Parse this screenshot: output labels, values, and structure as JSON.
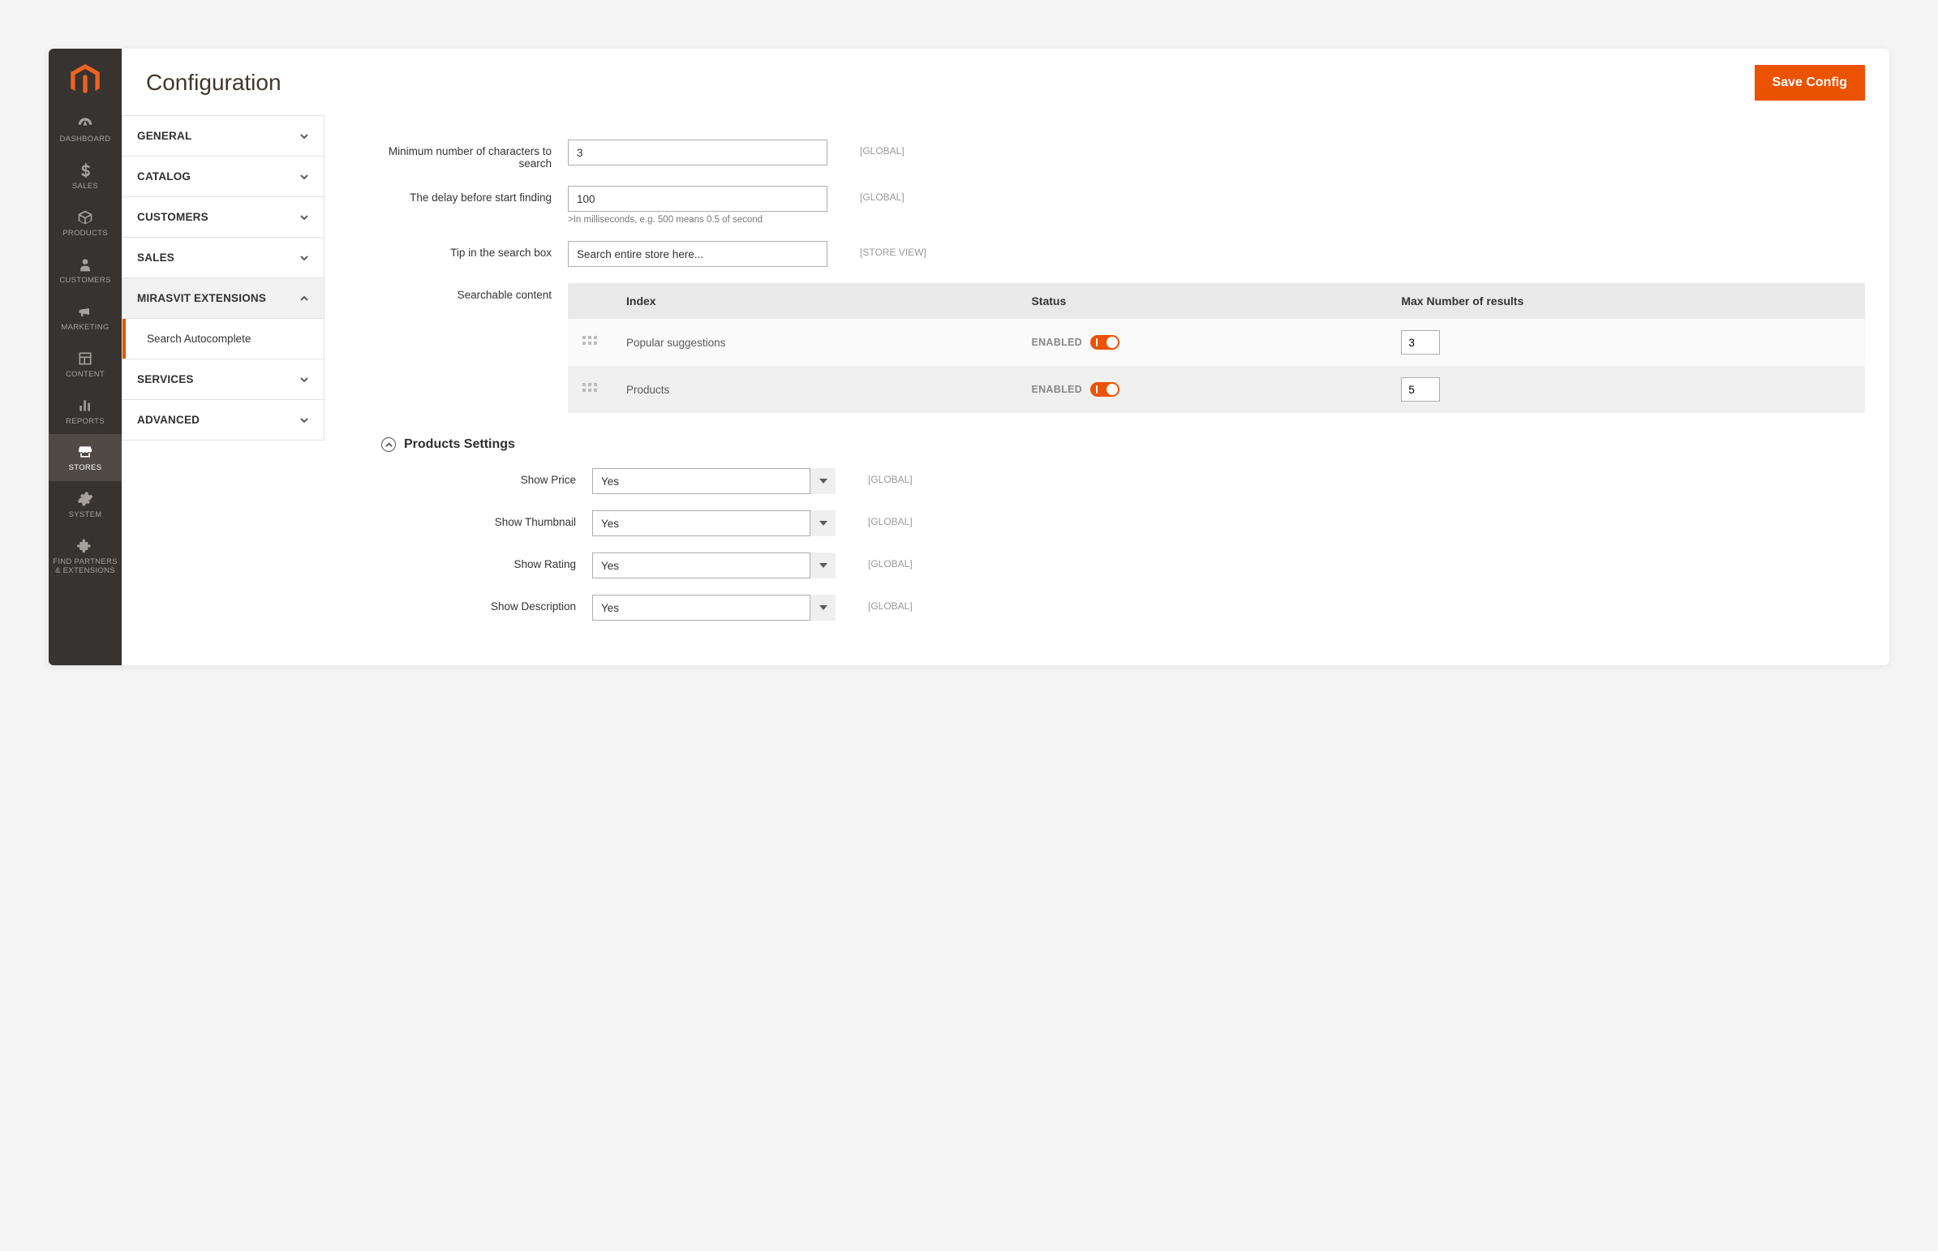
{
  "page": {
    "title": "Configuration",
    "save_button": "Save Config"
  },
  "sidebar": {
    "items": [
      {
        "id": "dashboard",
        "label": "DASHBOARD"
      },
      {
        "id": "sales",
        "label": "SALES"
      },
      {
        "id": "products",
        "label": "PRODUCTS"
      },
      {
        "id": "customers",
        "label": "CUSTOMERS"
      },
      {
        "id": "marketing",
        "label": "MARKETING"
      },
      {
        "id": "content",
        "label": "CONTENT"
      },
      {
        "id": "reports",
        "label": "REPORTS"
      },
      {
        "id": "stores",
        "label": "STORES",
        "active": true
      },
      {
        "id": "system",
        "label": "SYSTEM"
      },
      {
        "id": "partners",
        "label": "FIND PARTNERS & EXTENSIONS"
      }
    ]
  },
  "config_nav": {
    "sections": [
      {
        "label": "GENERAL",
        "expanded": false
      },
      {
        "label": "CATALOG",
        "expanded": false
      },
      {
        "label": "CUSTOMERS",
        "expanded": false
      },
      {
        "label": "SALES",
        "expanded": false
      },
      {
        "label": "MIRASVIT EXTENSIONS",
        "expanded": true,
        "sub": [
          {
            "label": "Search Autocomplete",
            "active": true
          }
        ]
      },
      {
        "label": "SERVICES",
        "expanded": false
      },
      {
        "label": "ADVANCED",
        "expanded": false
      }
    ]
  },
  "scopes": {
    "global": "[GLOBAL]",
    "store_view": "[STORE VIEW]"
  },
  "form": {
    "min_chars": {
      "label": "Minimum number of characters to search",
      "value": "3"
    },
    "delay": {
      "label": "The delay before start finding",
      "value": "100",
      "hint": ">In milliseconds, e.g. 500 means 0.5 of second"
    },
    "tip": {
      "label": "Tip in the search box",
      "value": "Search entire store here..."
    },
    "searchable": {
      "label": "Searchable content",
      "headers": {
        "index": "Index",
        "status": "Status",
        "max": "Max Number of results"
      },
      "status_enabled_label": "ENABLED",
      "rows": [
        {
          "index": "Popular suggestions",
          "enabled": true,
          "max": "3"
        },
        {
          "index": "Products",
          "enabled": true,
          "max": "5"
        }
      ]
    }
  },
  "products_section": {
    "title": "Products Settings",
    "fields": [
      {
        "key": "show_price",
        "label": "Show Price",
        "value": "Yes"
      },
      {
        "key": "show_thumbnail",
        "label": "Show Thumbnail",
        "value": "Yes"
      },
      {
        "key": "show_rating",
        "label": "Show Rating",
        "value": "Yes"
      },
      {
        "key": "show_description",
        "label": "Show Description",
        "value": "Yes"
      }
    ]
  }
}
